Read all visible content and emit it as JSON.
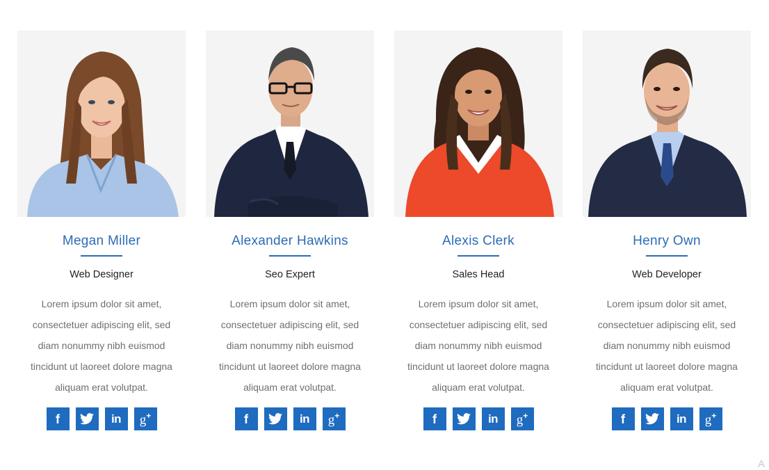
{
  "members": [
    {
      "name": "Megan Miller",
      "role": "Web Designer",
      "bio": [
        "Lorem ipsum dolor sit amet,",
        "consectetuer adipiscing elit, sed",
        "diam nonummy nibh euismod",
        "tincidunt ut laoreet dolore magna",
        "aliquam erat volutpat."
      ],
      "social": {
        "facebook": "f",
        "twitter": "twitter-bird",
        "linkedin": "in",
        "googleplus": "g+"
      }
    },
    {
      "name": "Alexander Hawkins",
      "role": "Seo Expert",
      "bio": [
        "Lorem ipsum dolor sit amet,",
        "consectetuer adipiscing elit, sed",
        "diam nonummy nibh euismod",
        "tincidunt ut laoreet dolore magna",
        "aliquam erat volutpat."
      ],
      "social": {
        "facebook": "f",
        "twitter": "twitter-bird",
        "linkedin": "in",
        "googleplus": "g+"
      }
    },
    {
      "name": "Alexis Clerk",
      "role": "Sales Head",
      "bio": [
        "Lorem ipsum dolor sit amet,",
        "consectetuer adipiscing elit, sed",
        "diam nonummy nibh euismod",
        "tincidunt ut laoreet dolore magna",
        "aliquam erat volutpat."
      ],
      "social": {
        "facebook": "f",
        "twitter": "twitter-bird",
        "linkedin": "in",
        "googleplus": "g+"
      }
    },
    {
      "name": "Henry Own",
      "role": "Web Developer",
      "bio": [
        "Lorem ipsum dolor sit amet,",
        "consectetuer adipiscing elit, sed",
        "diam nonummy nibh euismod",
        "tincidunt ut laoreet dolore magna",
        "aliquam erat volutpat."
      ],
      "social": {
        "facebook": "f",
        "twitter": "twitter-bird",
        "linkedin": "in",
        "googleplus": "g+"
      }
    }
  ],
  "colors": {
    "accent": "#2b6cb5",
    "social_bg": "#1e6bbf",
    "photo_bg": "#f4f4f4",
    "body_text": "#6f6f6f"
  },
  "corner_mark": "A"
}
